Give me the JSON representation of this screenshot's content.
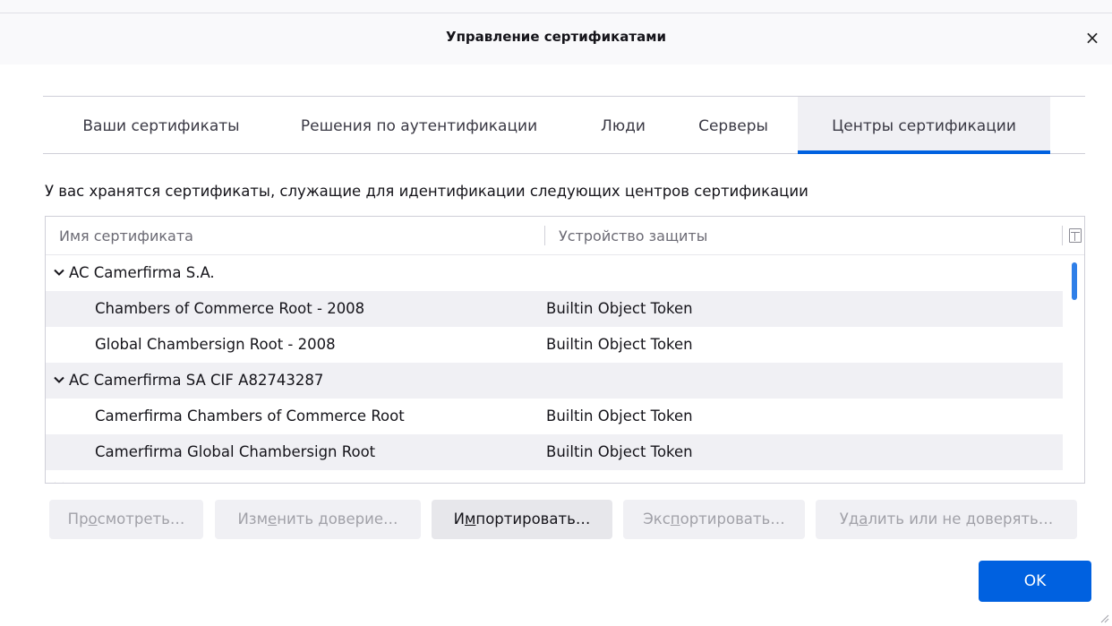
{
  "dialog": {
    "title": "Управление сертификатами",
    "close_glyph": "×"
  },
  "tabs": [
    {
      "label": "Ваши сертификаты",
      "active": false
    },
    {
      "label": "Решения по аутентификации",
      "active": false
    },
    {
      "label": "Люди",
      "active": false
    },
    {
      "label": "Серверы",
      "active": false
    },
    {
      "label": "Центры сертификации",
      "active": true
    }
  ],
  "description": "У вас хранятся сертификаты, служащие для идентификации следующих центров сертификации",
  "table": {
    "columns": [
      "Имя сертификата",
      "Устройство защиты"
    ],
    "column_picker_icon": "column-picker-icon",
    "rows": [
      {
        "type": "group",
        "name": "AC Camerfirma S.A.",
        "device": ""
      },
      {
        "type": "item",
        "name": "Chambers of Commerce Root - 2008",
        "device": "Builtin Object Token"
      },
      {
        "type": "item",
        "name": "Global Chambersign Root - 2008",
        "device": "Builtin Object Token"
      },
      {
        "type": "group",
        "name": "AC Camerfirma SA CIF A82743287",
        "device": ""
      },
      {
        "type": "item",
        "name": "Camerfirma Chambers of Commerce Root",
        "device": "Builtin Object Token"
      },
      {
        "type": "item",
        "name": "Camerfirma Global Chambersign Root",
        "device": "Builtin Object Token"
      }
    ]
  },
  "buttons": {
    "view": {
      "prefix": "Пр",
      "mnemonic": "о",
      "suffix": "смотреть…",
      "enabled": false
    },
    "edit_trust": {
      "prefix": "Изм",
      "mnemonic": "е",
      "suffix": "нить доверие…",
      "enabled": false
    },
    "import": {
      "prefix": "И",
      "mnemonic": "м",
      "suffix": "портировать…",
      "enabled": true
    },
    "export": {
      "prefix": "Экс",
      "mnemonic": "п",
      "suffix": "ортировать…",
      "enabled": false
    },
    "delete": {
      "prefix": "Уд",
      "mnemonic": "а",
      "suffix": "лить или не доверять…",
      "enabled": false
    }
  },
  "ok_label": "OK",
  "colors": {
    "accent": "#0061e0",
    "scroll_thumb": "#2f7fe8",
    "alt_row": "#f0f0f4"
  }
}
